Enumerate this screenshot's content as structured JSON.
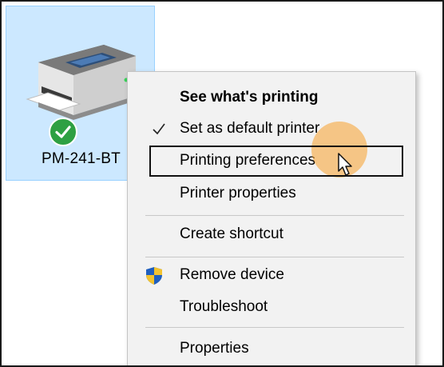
{
  "device": {
    "name": "PM-241-BT",
    "icon": "printer-icon",
    "status_icon": "check-circle-icon",
    "status_color": "#2ea043"
  },
  "context_menu": {
    "items": [
      {
        "label": "See what's printing",
        "bold": true
      },
      {
        "label": "Set as default printer",
        "checked": true,
        "icon": "checkmark-icon"
      },
      {
        "label": "Printing preferences",
        "highlighted": true
      },
      {
        "label": "Printer properties"
      },
      {
        "label": "Create shortcut"
      },
      {
        "label": "Remove device",
        "icon": "uac-shield-icon"
      },
      {
        "label": "Troubleshoot"
      },
      {
        "label": "Properties"
      }
    ]
  },
  "colors": {
    "selection_bg": "#cce8ff",
    "menu_bg": "#f2f2f2",
    "click_indicator": "#f7a63c"
  },
  "cursor": "arrow-cursor-icon"
}
